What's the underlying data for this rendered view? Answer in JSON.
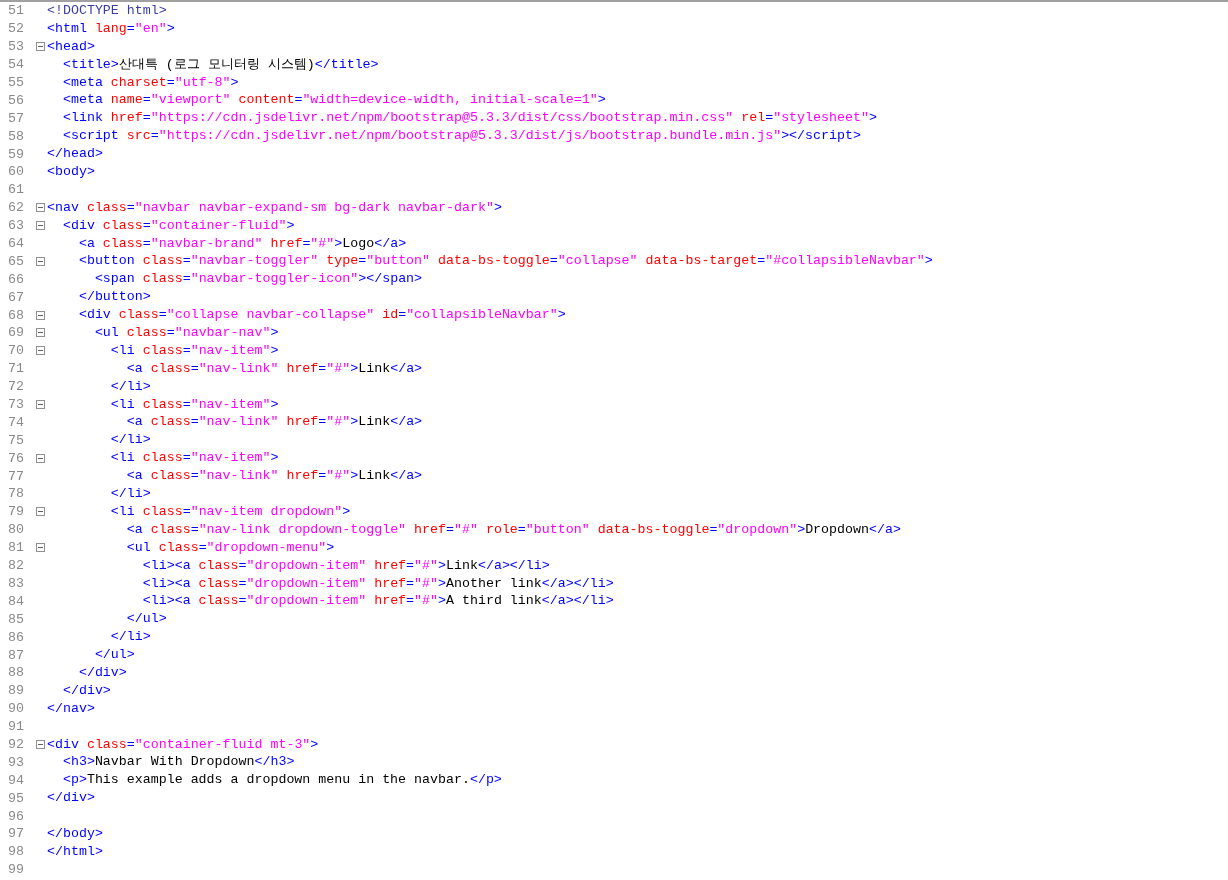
{
  "editor": {
    "lines": [
      {
        "number": "51",
        "foldable": false,
        "tokens": [
          {
            "kind": "doctype",
            "text": "<!DOCTYPE html>"
          }
        ]
      },
      {
        "number": "52",
        "foldable": false,
        "tokens": [
          {
            "kind": "tag",
            "text": "<html "
          },
          {
            "kind": "attr",
            "text": "lang"
          },
          {
            "kind": "tag",
            "text": "="
          },
          {
            "kind": "val",
            "text": "\"en\""
          },
          {
            "kind": "tag",
            "text": ">"
          }
        ]
      },
      {
        "number": "53",
        "foldable": true,
        "tokens": [
          {
            "kind": "tag",
            "text": "<head>"
          }
        ]
      },
      {
        "number": "54",
        "foldable": false,
        "tokens": [
          {
            "kind": "tag",
            "text": "  <title>"
          },
          {
            "kind": "text",
            "text": "산대특 (로그 모니터링 시스템)"
          },
          {
            "kind": "tag",
            "text": "</title>"
          }
        ]
      },
      {
        "number": "55",
        "foldable": false,
        "tokens": [
          {
            "kind": "tag",
            "text": "  <meta "
          },
          {
            "kind": "attr",
            "text": "charset"
          },
          {
            "kind": "tag",
            "text": "="
          },
          {
            "kind": "val",
            "text": "\"utf-8\""
          },
          {
            "kind": "tag",
            "text": ">"
          }
        ]
      },
      {
        "number": "56",
        "foldable": false,
        "tokens": [
          {
            "kind": "tag",
            "text": "  <meta "
          },
          {
            "kind": "attr",
            "text": "name"
          },
          {
            "kind": "tag",
            "text": "="
          },
          {
            "kind": "val",
            "text": "\"viewport\""
          },
          {
            "kind": "attr",
            "text": " content"
          },
          {
            "kind": "tag",
            "text": "="
          },
          {
            "kind": "val",
            "text": "\"width=device-width, initial-scale=1\""
          },
          {
            "kind": "tag",
            "text": ">"
          }
        ]
      },
      {
        "number": "57",
        "foldable": false,
        "tokens": [
          {
            "kind": "tag",
            "text": "  <link "
          },
          {
            "kind": "attr",
            "text": "href"
          },
          {
            "kind": "tag",
            "text": "="
          },
          {
            "kind": "val",
            "text": "\"https://cdn.jsdelivr.net/npm/bootstrap@5.3.3/dist/css/bootstrap.min.css\""
          },
          {
            "kind": "attr",
            "text": " rel"
          },
          {
            "kind": "tag",
            "text": "="
          },
          {
            "kind": "val",
            "text": "\"stylesheet\""
          },
          {
            "kind": "tag",
            "text": ">"
          }
        ]
      },
      {
        "number": "58",
        "foldable": false,
        "tokens": [
          {
            "kind": "tag",
            "text": "  <script "
          },
          {
            "kind": "attr",
            "text": "src"
          },
          {
            "kind": "tag",
            "text": "="
          },
          {
            "kind": "val",
            "text": "\"https://cdn.jsdelivr.net/npm/bootstrap@5.3.3/dist/js/bootstrap.bundle.min.js\""
          },
          {
            "kind": "tag",
            "text": "></script>"
          }
        ]
      },
      {
        "number": "59",
        "foldable": false,
        "tokens": [
          {
            "kind": "tag",
            "text": "</head>"
          }
        ]
      },
      {
        "number": "60",
        "foldable": false,
        "tokens": [
          {
            "kind": "tag",
            "text": "<body>"
          }
        ]
      },
      {
        "number": "61",
        "foldable": false
      },
      {
        "number": "62",
        "foldable": true,
        "tokens": [
          {
            "kind": "tag",
            "text": "<nav "
          },
          {
            "kind": "attr",
            "text": "class"
          },
          {
            "kind": "tag",
            "text": "="
          },
          {
            "kind": "val",
            "text": "\"navbar navbar-expand-sm bg-dark navbar-dark\""
          },
          {
            "kind": "tag",
            "text": ">"
          }
        ]
      },
      {
        "number": "63",
        "foldable": true,
        "tokens": [
          {
            "kind": "tag",
            "text": "  <div "
          },
          {
            "kind": "attr",
            "text": "class"
          },
          {
            "kind": "tag",
            "text": "="
          },
          {
            "kind": "val",
            "text": "\"container-fluid\""
          },
          {
            "kind": "tag",
            "text": ">"
          }
        ]
      },
      {
        "number": "64",
        "foldable": false,
        "tokens": [
          {
            "kind": "tag",
            "text": "    <a "
          },
          {
            "kind": "attr",
            "text": "class"
          },
          {
            "kind": "tag",
            "text": "="
          },
          {
            "kind": "val",
            "text": "\"navbar-brand\""
          },
          {
            "kind": "attr",
            "text": " href"
          },
          {
            "kind": "tag",
            "text": "="
          },
          {
            "kind": "val",
            "text": "\"#\""
          },
          {
            "kind": "tag",
            "text": ">"
          },
          {
            "kind": "text",
            "text": "Logo"
          },
          {
            "kind": "tag",
            "text": "</a>"
          }
        ]
      },
      {
        "number": "65",
        "foldable": true,
        "tokens": [
          {
            "kind": "tag",
            "text": "    <button "
          },
          {
            "kind": "attr",
            "text": "class"
          },
          {
            "kind": "tag",
            "text": "="
          },
          {
            "kind": "val",
            "text": "\"navbar-toggler\""
          },
          {
            "kind": "attr",
            "text": " type"
          },
          {
            "kind": "tag",
            "text": "="
          },
          {
            "kind": "val",
            "text": "\"button\""
          },
          {
            "kind": "attr",
            "text": " data-bs-toggle"
          },
          {
            "kind": "tag",
            "text": "="
          },
          {
            "kind": "val",
            "text": "\"collapse\""
          },
          {
            "kind": "attr",
            "text": " data-bs-target"
          },
          {
            "kind": "tag",
            "text": "="
          },
          {
            "kind": "val",
            "text": "\"#collapsibleNavbar\""
          },
          {
            "kind": "tag",
            "text": ">"
          }
        ]
      },
      {
        "number": "66",
        "foldable": false,
        "tokens": [
          {
            "kind": "tag",
            "text": "      <span "
          },
          {
            "kind": "attr",
            "text": "class"
          },
          {
            "kind": "tag",
            "text": "="
          },
          {
            "kind": "val",
            "text": "\"navbar-toggler-icon\""
          },
          {
            "kind": "tag",
            "text": "></span>"
          }
        ]
      },
      {
        "number": "67",
        "foldable": false,
        "tokens": [
          {
            "kind": "tag",
            "text": "    </button>"
          }
        ]
      },
      {
        "number": "68",
        "foldable": true,
        "tokens": [
          {
            "kind": "tag",
            "text": "    <div "
          },
          {
            "kind": "attr",
            "text": "class"
          },
          {
            "kind": "tag",
            "text": "="
          },
          {
            "kind": "val",
            "text": "\"collapse navbar-collapse\""
          },
          {
            "kind": "attr",
            "text": " id"
          },
          {
            "kind": "tag",
            "text": "="
          },
          {
            "kind": "val",
            "text": "\"collapsibleNavbar\""
          },
          {
            "kind": "tag",
            "text": ">"
          }
        ]
      },
      {
        "number": "69",
        "foldable": true,
        "tokens": [
          {
            "kind": "tag",
            "text": "      <ul "
          },
          {
            "kind": "attr",
            "text": "class"
          },
          {
            "kind": "tag",
            "text": "="
          },
          {
            "kind": "val",
            "text": "\"navbar-nav\""
          },
          {
            "kind": "tag",
            "text": ">"
          }
        ]
      },
      {
        "number": "70",
        "foldable": true,
        "tokens": [
          {
            "kind": "tag",
            "text": "        <li "
          },
          {
            "kind": "attr",
            "text": "class"
          },
          {
            "kind": "tag",
            "text": "="
          },
          {
            "kind": "val",
            "text": "\"nav-item\""
          },
          {
            "kind": "tag",
            "text": ">"
          }
        ]
      },
      {
        "number": "71",
        "foldable": false,
        "tokens": [
          {
            "kind": "tag",
            "text": "          <a "
          },
          {
            "kind": "attr",
            "text": "class"
          },
          {
            "kind": "tag",
            "text": "="
          },
          {
            "kind": "val",
            "text": "\"nav-link\""
          },
          {
            "kind": "attr",
            "text": " href"
          },
          {
            "kind": "tag",
            "text": "="
          },
          {
            "kind": "val",
            "text": "\"#\""
          },
          {
            "kind": "tag",
            "text": ">"
          },
          {
            "kind": "text",
            "text": "Link"
          },
          {
            "kind": "tag",
            "text": "</a>"
          }
        ]
      },
      {
        "number": "72",
        "foldable": false,
        "tokens": [
          {
            "kind": "tag",
            "text": "        </li>"
          }
        ]
      },
      {
        "number": "73",
        "foldable": true,
        "tokens": [
          {
            "kind": "tag",
            "text": "        <li "
          },
          {
            "kind": "attr",
            "text": "class"
          },
          {
            "kind": "tag",
            "text": "="
          },
          {
            "kind": "val",
            "text": "\"nav-item\""
          },
          {
            "kind": "tag",
            "text": ">"
          }
        ]
      },
      {
        "number": "74",
        "foldable": false,
        "tokens": [
          {
            "kind": "tag",
            "text": "          <a "
          },
          {
            "kind": "attr",
            "text": "class"
          },
          {
            "kind": "tag",
            "text": "="
          },
          {
            "kind": "val",
            "text": "\"nav-link\""
          },
          {
            "kind": "attr",
            "text": " href"
          },
          {
            "kind": "tag",
            "text": "="
          },
          {
            "kind": "val",
            "text": "\"#\""
          },
          {
            "kind": "tag",
            "text": ">"
          },
          {
            "kind": "text",
            "text": "Link"
          },
          {
            "kind": "tag",
            "text": "</a>"
          }
        ]
      },
      {
        "number": "75",
        "foldable": false,
        "tokens": [
          {
            "kind": "tag",
            "text": "        </li>"
          }
        ]
      },
      {
        "number": "76",
        "foldable": true,
        "tokens": [
          {
            "kind": "tag",
            "text": "        <li "
          },
          {
            "kind": "attr",
            "text": "class"
          },
          {
            "kind": "tag",
            "text": "="
          },
          {
            "kind": "val",
            "text": "\"nav-item\""
          },
          {
            "kind": "tag",
            "text": ">"
          }
        ]
      },
      {
        "number": "77",
        "foldable": false,
        "tokens": [
          {
            "kind": "tag",
            "text": "          <a "
          },
          {
            "kind": "attr",
            "text": "class"
          },
          {
            "kind": "tag",
            "text": "="
          },
          {
            "kind": "val",
            "text": "\"nav-link\""
          },
          {
            "kind": "attr",
            "text": " href"
          },
          {
            "kind": "tag",
            "text": "="
          },
          {
            "kind": "val",
            "text": "\"#\""
          },
          {
            "kind": "tag",
            "text": ">"
          },
          {
            "kind": "text",
            "text": "Link"
          },
          {
            "kind": "tag",
            "text": "</a>"
          }
        ]
      },
      {
        "number": "78",
        "foldable": false,
        "tokens": [
          {
            "kind": "tag",
            "text": "        </li>"
          }
        ]
      },
      {
        "number": "79",
        "foldable": true,
        "tokens": [
          {
            "kind": "tag",
            "text": "        <li "
          },
          {
            "kind": "attr",
            "text": "class"
          },
          {
            "kind": "tag",
            "text": "="
          },
          {
            "kind": "val",
            "text": "\"nav-item dropdown\""
          },
          {
            "kind": "tag",
            "text": ">"
          }
        ]
      },
      {
        "number": "80",
        "foldable": false,
        "tokens": [
          {
            "kind": "tag",
            "text": "          <a "
          },
          {
            "kind": "attr",
            "text": "class"
          },
          {
            "kind": "tag",
            "text": "="
          },
          {
            "kind": "val",
            "text": "\"nav-link dropdown-toggle\""
          },
          {
            "kind": "attr",
            "text": " href"
          },
          {
            "kind": "tag",
            "text": "="
          },
          {
            "kind": "val",
            "text": "\"#\""
          },
          {
            "kind": "attr",
            "text": " role"
          },
          {
            "kind": "tag",
            "text": "="
          },
          {
            "kind": "val",
            "text": "\"button\""
          },
          {
            "kind": "attr",
            "text": " data-bs-toggle"
          },
          {
            "kind": "tag",
            "text": "="
          },
          {
            "kind": "val",
            "text": "\"dropdown\""
          },
          {
            "kind": "tag",
            "text": ">"
          },
          {
            "kind": "text",
            "text": "Dropdown"
          },
          {
            "kind": "tag",
            "text": "</a>"
          }
        ]
      },
      {
        "number": "81",
        "foldable": true,
        "tokens": [
          {
            "kind": "tag",
            "text": "          <ul "
          },
          {
            "kind": "attr",
            "text": "class"
          },
          {
            "kind": "tag",
            "text": "="
          },
          {
            "kind": "val",
            "text": "\"dropdown-menu\""
          },
          {
            "kind": "tag",
            "text": ">"
          }
        ]
      },
      {
        "number": "82",
        "foldable": false,
        "tokens": [
          {
            "kind": "tag",
            "text": "            <li><a "
          },
          {
            "kind": "attr",
            "text": "class"
          },
          {
            "kind": "tag",
            "text": "="
          },
          {
            "kind": "val",
            "text": "\"dropdown-item\""
          },
          {
            "kind": "attr",
            "text": " href"
          },
          {
            "kind": "tag",
            "text": "="
          },
          {
            "kind": "val",
            "text": "\"#\""
          },
          {
            "kind": "tag",
            "text": ">"
          },
          {
            "kind": "text",
            "text": "Link"
          },
          {
            "kind": "tag",
            "text": "</a></li>"
          }
        ]
      },
      {
        "number": "83",
        "foldable": false,
        "tokens": [
          {
            "kind": "tag",
            "text": "            <li><a "
          },
          {
            "kind": "attr",
            "text": "class"
          },
          {
            "kind": "tag",
            "text": "="
          },
          {
            "kind": "val",
            "text": "\"dropdown-item\""
          },
          {
            "kind": "attr",
            "text": " href"
          },
          {
            "kind": "tag",
            "text": "="
          },
          {
            "kind": "val",
            "text": "\"#\""
          },
          {
            "kind": "tag",
            "text": ">"
          },
          {
            "kind": "text",
            "text": "Another link"
          },
          {
            "kind": "tag",
            "text": "</a></li>"
          }
        ]
      },
      {
        "number": "84",
        "foldable": false,
        "tokens": [
          {
            "kind": "tag",
            "text": "            <li><a "
          },
          {
            "kind": "attr",
            "text": "class"
          },
          {
            "kind": "tag",
            "text": "="
          },
          {
            "kind": "val",
            "text": "\"dropdown-item\""
          },
          {
            "kind": "attr",
            "text": " href"
          },
          {
            "kind": "tag",
            "text": "="
          },
          {
            "kind": "val",
            "text": "\"#\""
          },
          {
            "kind": "tag",
            "text": ">"
          },
          {
            "kind": "text",
            "text": "A third link"
          },
          {
            "kind": "tag",
            "text": "</a></li>"
          }
        ]
      },
      {
        "number": "85",
        "foldable": false,
        "tokens": [
          {
            "kind": "tag",
            "text": "          </ul>"
          }
        ]
      },
      {
        "number": "86",
        "foldable": false,
        "tokens": [
          {
            "kind": "tag",
            "text": "        </li>"
          }
        ]
      },
      {
        "number": "87",
        "foldable": false,
        "tokens": [
          {
            "kind": "tag",
            "text": "      </ul>"
          }
        ]
      },
      {
        "number": "88",
        "foldable": false,
        "tokens": [
          {
            "kind": "tag",
            "text": "    </div>"
          }
        ]
      },
      {
        "number": "89",
        "foldable": false,
        "tokens": [
          {
            "kind": "tag",
            "text": "  </div>"
          }
        ]
      },
      {
        "number": "90",
        "foldable": false,
        "tokens": [
          {
            "kind": "tag",
            "text": "</nav>"
          }
        ]
      },
      {
        "number": "91",
        "foldable": false
      },
      {
        "number": "92",
        "foldable": true,
        "tokens": [
          {
            "kind": "tag",
            "text": "<div "
          },
          {
            "kind": "attr",
            "text": "class"
          },
          {
            "kind": "tag",
            "text": "="
          },
          {
            "kind": "val",
            "text": "\"container-fluid mt-3\""
          },
          {
            "kind": "tag",
            "text": ">"
          }
        ]
      },
      {
        "number": "93",
        "foldable": false,
        "tokens": [
          {
            "kind": "tag",
            "text": "  <h3>"
          },
          {
            "kind": "text",
            "text": "Navbar With Dropdown"
          },
          {
            "kind": "tag",
            "text": "</h3>"
          }
        ]
      },
      {
        "number": "94",
        "foldable": false,
        "tokens": [
          {
            "kind": "tag",
            "text": "  <p>"
          },
          {
            "kind": "text",
            "text": "This example adds a dropdown menu in the navbar."
          },
          {
            "kind": "tag",
            "text": "</p>"
          }
        ]
      },
      {
        "number": "95",
        "foldable": false,
        "tokens": [
          {
            "kind": "tag",
            "text": "</div>"
          }
        ]
      },
      {
        "number": "96",
        "foldable": false
      },
      {
        "number": "97",
        "foldable": false,
        "tokens": [
          {
            "kind": "tag",
            "text": "</body>"
          }
        ]
      },
      {
        "number": "98",
        "foldable": false,
        "tokens": [
          {
            "kind": "tag",
            "text": "</html>"
          }
        ]
      },
      {
        "number": "99",
        "foldable": false
      }
    ]
  }
}
